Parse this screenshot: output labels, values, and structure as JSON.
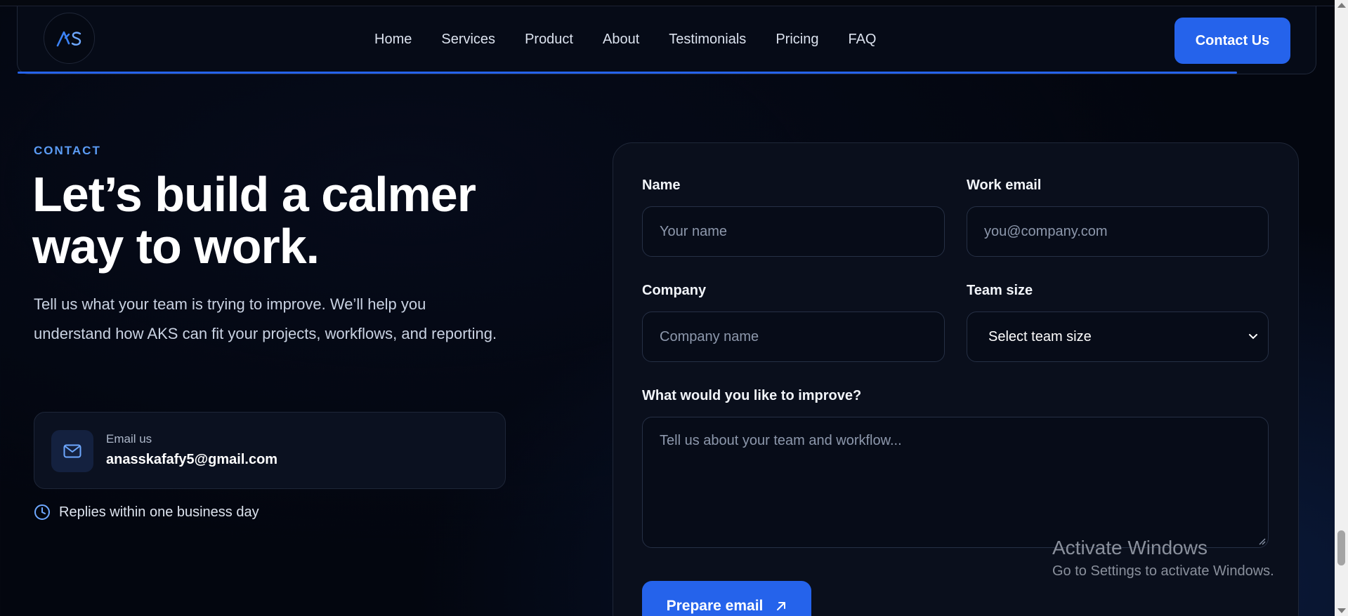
{
  "nav": {
    "logo_text": "AKS",
    "links": [
      "Home",
      "Services",
      "Product",
      "About",
      "Testimonials",
      "Pricing",
      "FAQ"
    ],
    "cta": "Contact Us"
  },
  "hero": {
    "eyebrow": "CONTACT",
    "headline_line1": "Let’s build a calmer",
    "headline_line2": "way to work.",
    "lead": "Tell us what your team is trying to improve. We’ll help you understand how AKS can fit your projects, workflows, and reporting.",
    "email_label": "Email us",
    "email_value": "anasskafafy5@gmail.com",
    "reply_note": "Replies within one business day"
  },
  "form": {
    "name_label": "Name",
    "name_placeholder": "Your name",
    "email_label": "Work email",
    "email_placeholder": "you@company.com",
    "company_label": "Company",
    "company_placeholder": "Company name",
    "team_label": "Team size",
    "team_selected": "Select team size",
    "improve_label": "What would you like to improve?",
    "improve_placeholder": "Tell us about your team and workflow...",
    "submit": "Prepare email"
  },
  "watermark": {
    "title": "Activate Windows",
    "subtitle": "Go to Settings to activate Windows."
  },
  "colors": {
    "accent": "#2563eb",
    "eyebrow": "#5b9cf5",
    "background": "#03060f"
  }
}
